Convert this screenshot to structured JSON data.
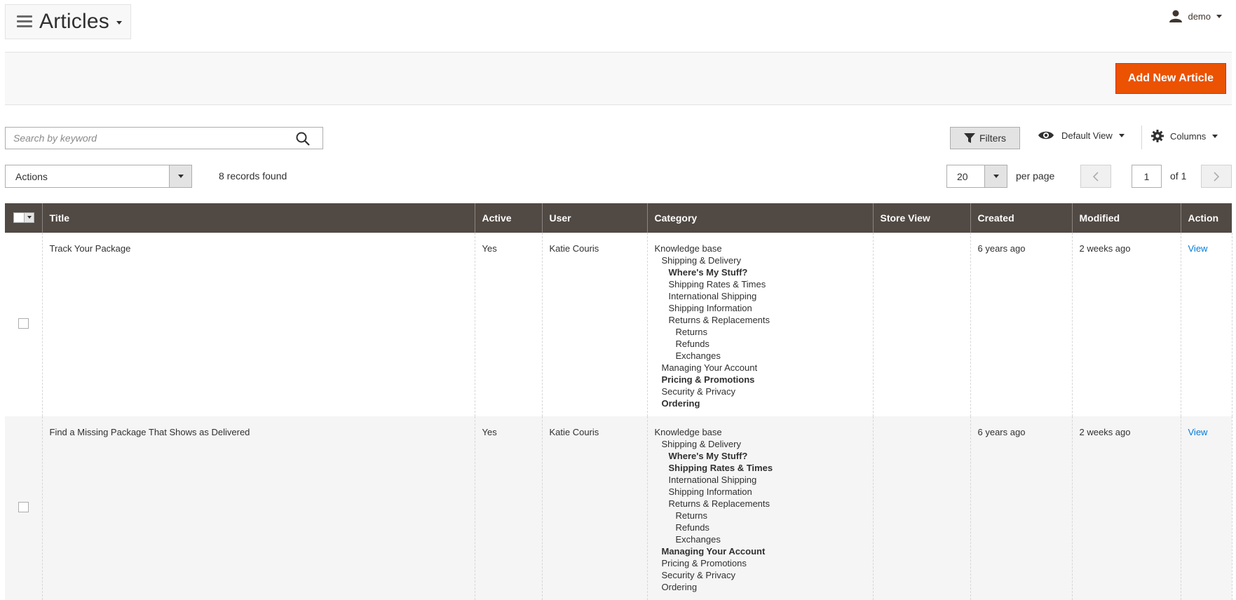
{
  "header": {
    "page_title": "Articles",
    "user": "demo"
  },
  "actions_bar": {
    "add_button_label": "Add New Article",
    "accent_color": "#eb5202"
  },
  "toolbar": {
    "search_placeholder": "Search by keyword",
    "filters_label": "Filters",
    "view_label": "Default View",
    "columns_label": "Columns",
    "actions_label": "Actions",
    "records_found": "8 records found",
    "per_page_value": "20",
    "per_page_label": "per page",
    "page_number": "1",
    "page_of": "of 1"
  },
  "grid": {
    "header_color": "#514943",
    "columns": [
      "Title",
      "Active",
      "User",
      "Category",
      "Store View",
      "Created",
      "Modified",
      "Action"
    ],
    "rows": [
      {
        "title": "Track Your Package",
        "active": "Yes",
        "user": "Katie Couris",
        "store_view": "",
        "created": "6 years ago",
        "modified": "2 weeks ago",
        "action": "View",
        "categories": [
          {
            "label": "Knowledge base",
            "level": 0,
            "selected": false
          },
          {
            "label": "Shipping & Delivery",
            "level": 1,
            "selected": false
          },
          {
            "label": "Where's My Stuff?",
            "level": 2,
            "selected": true
          },
          {
            "label": "Shipping Rates & Times",
            "level": 2,
            "selected": false
          },
          {
            "label": "International Shipping",
            "level": 2,
            "selected": false
          },
          {
            "label": "Shipping Information",
            "level": 2,
            "selected": false
          },
          {
            "label": "Returns & Replacements",
            "level": 2,
            "selected": false
          },
          {
            "label": "Returns",
            "level": 3,
            "selected": false
          },
          {
            "label": "Refunds",
            "level": 3,
            "selected": false
          },
          {
            "label": "Exchanges",
            "level": 3,
            "selected": false
          },
          {
            "label": "Managing Your Account",
            "level": 1,
            "selected": false
          },
          {
            "label": "Pricing & Promotions",
            "level": 1,
            "selected": true
          },
          {
            "label": "Security & Privacy",
            "level": 1,
            "selected": false
          },
          {
            "label": "Ordering",
            "level": 1,
            "selected": true
          }
        ]
      },
      {
        "title": "Find a Missing Package That Shows as Delivered",
        "active": "Yes",
        "user": "Katie Couris",
        "store_view": "",
        "created": "6 years ago",
        "modified": "2 weeks ago",
        "action": "View",
        "categories": [
          {
            "label": "Knowledge base",
            "level": 0,
            "selected": false
          },
          {
            "label": "Shipping & Delivery",
            "level": 1,
            "selected": false
          },
          {
            "label": "Where's My Stuff?",
            "level": 2,
            "selected": true
          },
          {
            "label": "Shipping Rates & Times",
            "level": 2,
            "selected": true
          },
          {
            "label": "International Shipping",
            "level": 2,
            "selected": false
          },
          {
            "label": "Shipping Information",
            "level": 2,
            "selected": false
          },
          {
            "label": "Returns & Replacements",
            "level": 2,
            "selected": false
          },
          {
            "label": "Returns",
            "level": 3,
            "selected": false
          },
          {
            "label": "Refunds",
            "level": 3,
            "selected": false
          },
          {
            "label": "Exchanges",
            "level": 3,
            "selected": false
          },
          {
            "label": "Managing Your Account",
            "level": 1,
            "selected": true
          },
          {
            "label": "Pricing & Promotions",
            "level": 1,
            "selected": false
          },
          {
            "label": "Security & Privacy",
            "level": 1,
            "selected": false
          },
          {
            "label": "Ordering",
            "level": 1,
            "selected": false
          }
        ]
      }
    ]
  }
}
